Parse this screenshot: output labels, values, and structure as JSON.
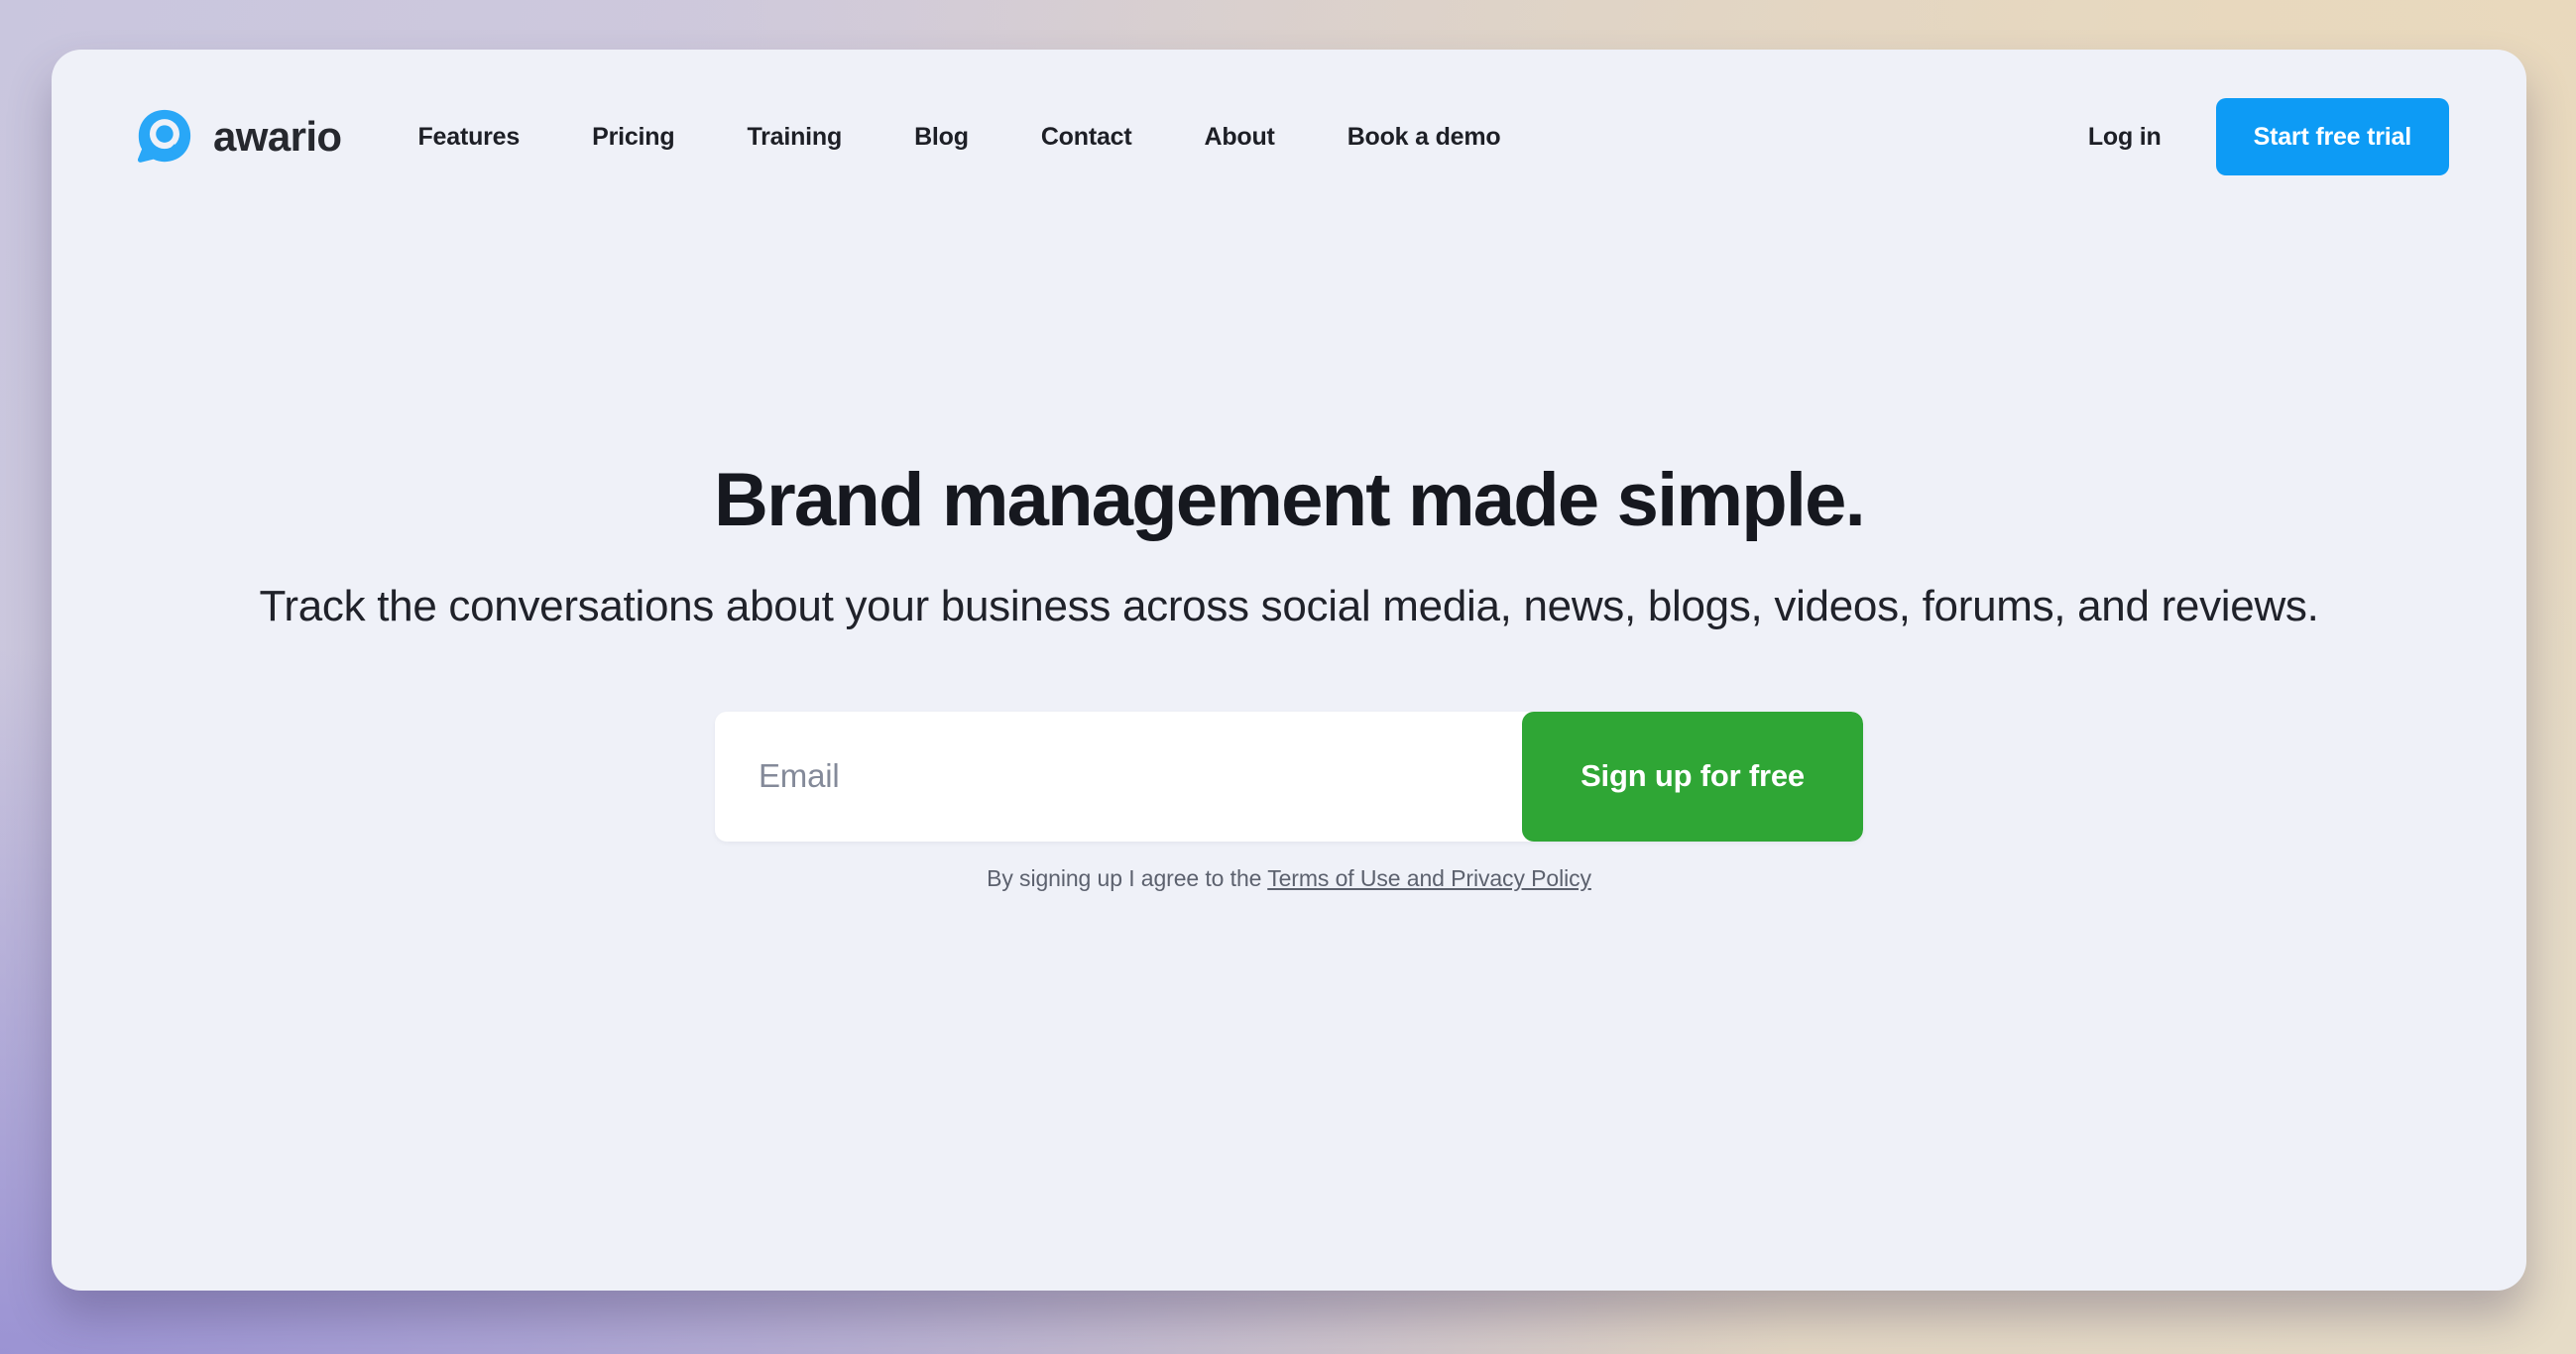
{
  "brand": {
    "name": "awario",
    "logo_icon": "awario-speech-bubble-search-logo",
    "accent_color": "#0d9bf5"
  },
  "header": {
    "nav": [
      {
        "label": "Features"
      },
      {
        "label": "Pricing"
      },
      {
        "label": "Training"
      },
      {
        "label": "Blog"
      },
      {
        "label": "Contact"
      },
      {
        "label": "About"
      },
      {
        "label": "Book a demo"
      }
    ],
    "login_label": "Log in",
    "cta_label": "Start free trial",
    "cta_color": "#0d9bf5"
  },
  "hero": {
    "title": "Brand management made simple.",
    "subtitle": "Track the conversations about your business across social media, news, blogs, videos, forums, and reviews."
  },
  "signup": {
    "email_placeholder": "Email",
    "email_value": "",
    "button_label": "Sign up for free",
    "button_color": "#2fa635",
    "terms_prefix": "By signing up I agree to the ",
    "terms_link": "Terms of Use and Privacy Policy"
  },
  "theme": {
    "card_background": "#eff1f8",
    "backdrop_left": "#9b93d3",
    "backdrop_right": "#e9d9bd",
    "text_color": "#16181f",
    "muted_text_color": "#5c616e"
  }
}
